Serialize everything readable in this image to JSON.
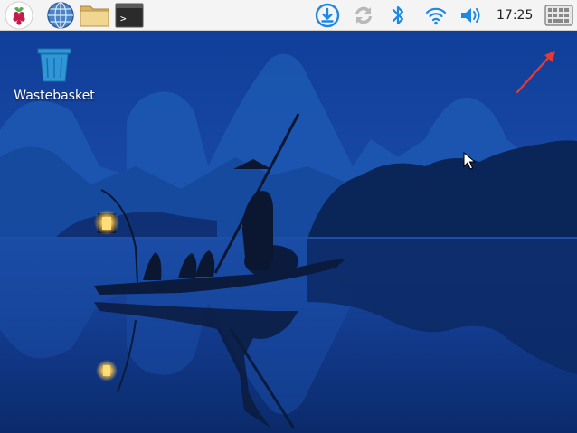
{
  "taskbar": {
    "menu_icon": "raspberry-icon",
    "launchers": [
      {
        "name": "web-browser",
        "icon": "globe-icon"
      },
      {
        "name": "file-manager",
        "icon": "folder-icon"
      },
      {
        "name": "terminal",
        "icon": "terminal-icon",
        "glyph": ">_"
      }
    ],
    "tray": [
      {
        "name": "updates",
        "icon": "download-icon"
      },
      {
        "name": "vnc",
        "icon": "sync-icon"
      },
      {
        "name": "bluetooth",
        "icon": "bluetooth-icon"
      },
      {
        "name": "wifi",
        "icon": "wifi-icon"
      },
      {
        "name": "volume",
        "icon": "speaker-icon"
      }
    ],
    "clock": "17:25",
    "keyboard_icon": "keyboard-icon",
    "accent_color": "#1e88e5"
  },
  "desktop": {
    "icons": [
      {
        "label": "Wastebasket",
        "icon": "trash-icon"
      }
    ],
    "wallpaper": "night-river-fisherman",
    "annotation_color": "#e53935"
  }
}
